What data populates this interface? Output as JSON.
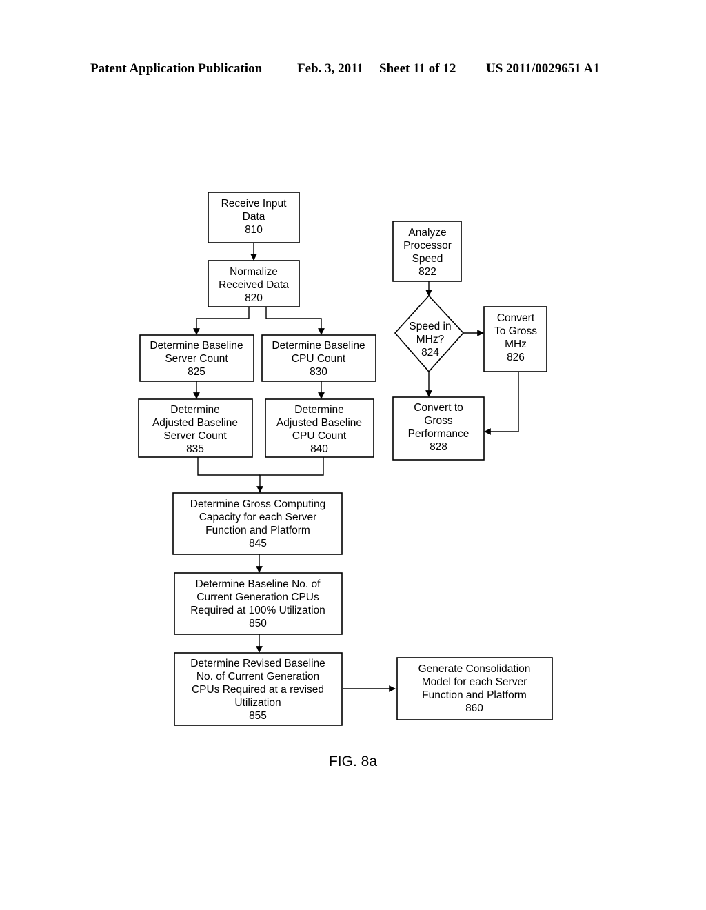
{
  "header": {
    "publication": "Patent Application Publication",
    "date": "Feb. 3, 2011",
    "sheet": "Sheet 11 of 12",
    "number": "US 2011/0029651 A1"
  },
  "figure_label": "FIG. 8a",
  "nodes": {
    "n810": {
      "shape": "process",
      "lines": [
        "Receive Input",
        "Data",
        "810"
      ]
    },
    "n820": {
      "shape": "process",
      "lines": [
        "Normalize",
        "Received Data",
        "820"
      ]
    },
    "n825": {
      "shape": "process",
      "lines": [
        "Determine Baseline",
        "Server Count",
        "825"
      ]
    },
    "n830": {
      "shape": "process",
      "lines": [
        "Determine Baseline",
        "CPU Count",
        "830"
      ]
    },
    "n835": {
      "shape": "process",
      "lines": [
        "Determine",
        "Adjusted Baseline",
        "Server Count",
        "835"
      ]
    },
    "n840": {
      "shape": "process",
      "lines": [
        "Determine",
        "Adjusted Baseline",
        "CPU Count",
        "840"
      ]
    },
    "n845": {
      "shape": "process",
      "lines": [
        "Determine Gross Computing",
        "Capacity for each Server",
        "Function and Platform",
        "845"
      ]
    },
    "n850": {
      "shape": "process",
      "lines": [
        "Determine Baseline No. of",
        "Current Generation CPUs",
        "Required at 100% Utilization",
        "850"
      ]
    },
    "n855": {
      "shape": "process",
      "lines": [
        "Determine Revised Baseline",
        "No. of Current Generation",
        "CPUs Required at a revised",
        "Utilization",
        "855"
      ]
    },
    "n860": {
      "shape": "process",
      "lines": [
        "Generate Consolidation",
        "Model for each Server",
        "Function and Platform",
        "860"
      ]
    },
    "n822": {
      "shape": "process",
      "lines": [
        "Analyze",
        "Processor",
        "Speed",
        "822"
      ]
    },
    "n824": {
      "shape": "decision",
      "lines": [
        "Speed in",
        "MHz?",
        "824"
      ]
    },
    "n826": {
      "shape": "process",
      "lines": [
        "Convert",
        "To Gross",
        "MHz",
        "826"
      ]
    },
    "n828": {
      "shape": "process",
      "lines": [
        "Convert to",
        "Gross",
        "Performance",
        "828"
      ]
    }
  },
  "edges": [
    {
      "from": "810",
      "to": "820"
    },
    {
      "from": "820",
      "to": "825"
    },
    {
      "from": "820",
      "to": "830"
    },
    {
      "from": "825",
      "to": "835"
    },
    {
      "from": "830",
      "to": "840"
    },
    {
      "from": "835",
      "to": "845"
    },
    {
      "from": "840",
      "to": "845"
    },
    {
      "from": "845",
      "to": "850"
    },
    {
      "from": "850",
      "to": "855"
    },
    {
      "from": "855",
      "to": "860"
    },
    {
      "from": "822",
      "to": "824"
    },
    {
      "from": "824",
      "to": "826"
    },
    {
      "from": "824",
      "to": "828"
    },
    {
      "from": "826",
      "to": "828"
    }
  ]
}
